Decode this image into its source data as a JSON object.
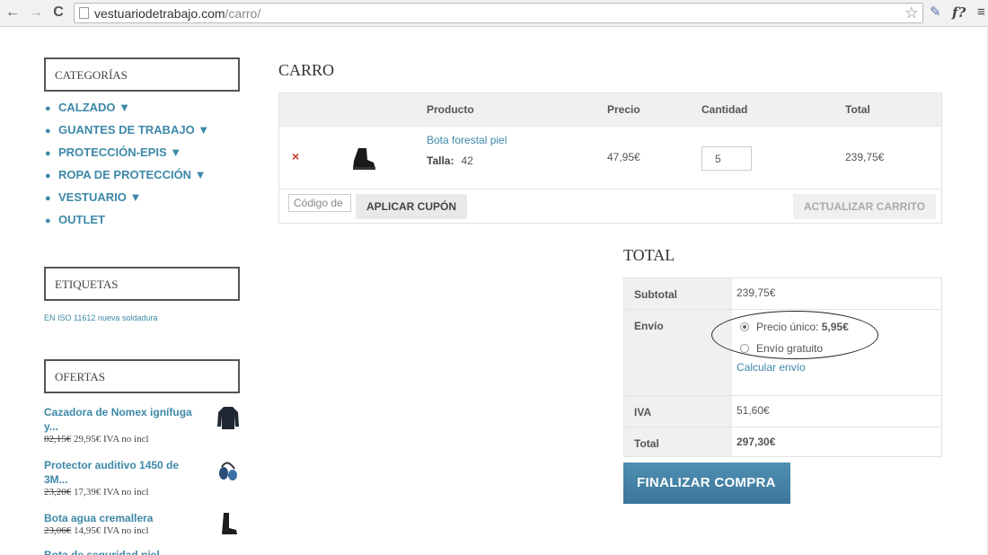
{
  "browser": {
    "url_host": "vestuariodetrabajo.com",
    "url_path": "/carro/",
    "ext_label": "f?"
  },
  "sidebar": {
    "categories_title": "CATEGORÍAS",
    "categories": [
      "CALZADO ▼",
      "GUANTES DE TRABAJO ▼",
      "PROTECCIÓN-EPIS ▼",
      "ROPA DE PROTECCIÓN ▼",
      "VESTUARIO ▼",
      "OUTLET"
    ],
    "tags_title": "ETIQUETAS",
    "tag": "EN ISO 11612 nueva soldadura",
    "offers_title": "OFERTAS",
    "offers": [
      {
        "name": "Cazadora de Nomex ignífuga y...",
        "old": "82,15€",
        "price": "29,95€",
        "tax": "IVA no incl"
      },
      {
        "name": "Protector auditivo 1450 de 3M...",
        "old": "23,20€",
        "price": "17,39€",
        "tax": "IVA no incl"
      },
      {
        "name": "Bota agua cremallera",
        "old": "23,06€",
        "price": "14,95€",
        "tax": "IVA no incl"
      },
      {
        "name": "Bota de seguridad piel",
        "old": "",
        "price": "",
        "tax": ""
      }
    ]
  },
  "cart": {
    "title": "CARRO",
    "headers": {
      "product": "Producto",
      "price": "Precio",
      "qty": "Cantidad",
      "total": "Total"
    },
    "item": {
      "remove": "×",
      "name": "Bota forestal piel",
      "attr_label": "Talla:",
      "attr_value": "42",
      "price": "47,95€",
      "qty": "5",
      "total": "239,75€"
    },
    "coupon_placeholder": "Código de",
    "apply_coupon": "APLICAR CUPÓN",
    "update_cart": "ACTUALIZAR CARRITO"
  },
  "totals": {
    "title": "TOTAL",
    "subtotal_label": "Subtotal",
    "subtotal": "239,75€",
    "shipping_label": "Envío",
    "ship_option1_label": "Precio único:",
    "ship_option1_price": "5,95€",
    "ship_option2_label": "Envío gratuito",
    "calc_shipping": "Calcular envío",
    "tax_label": "IVA",
    "tax": "51,60€",
    "total_label": "Total",
    "total": "297,30€",
    "checkout": "FINALIZAR COMPRA"
  },
  "colors": {
    "link": "#3d88a8",
    "checkout": "#3b7698",
    "remove": "#c0392b"
  }
}
